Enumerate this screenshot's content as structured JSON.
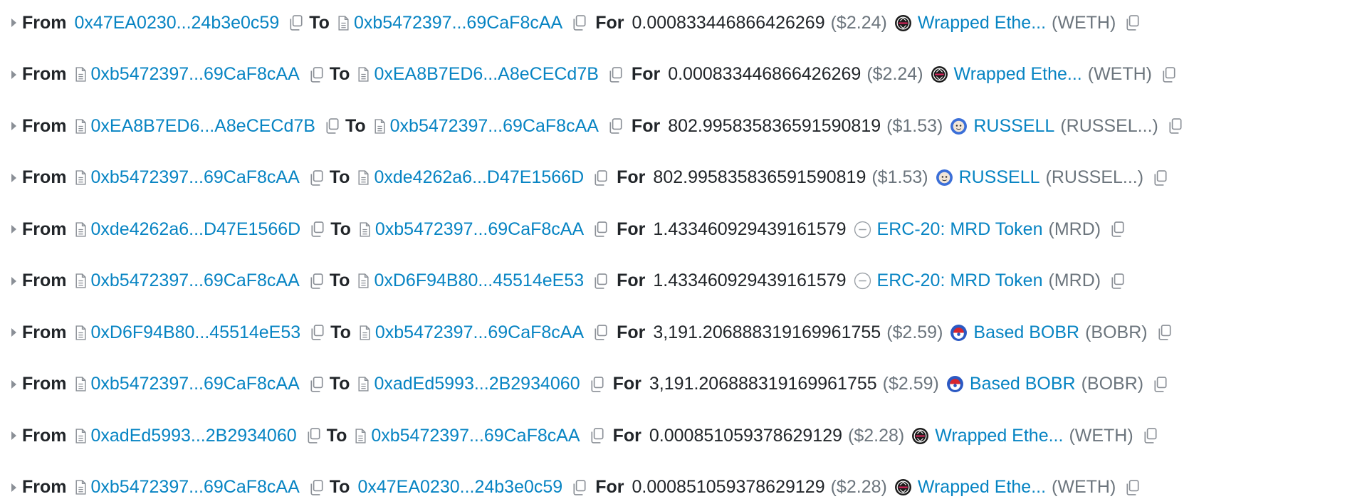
{
  "labels": {
    "from": "From",
    "to": "To",
    "for": "For"
  },
  "rows": [
    {
      "from": {
        "addr": "0x47EA0230...24b3e0c59",
        "contract": false
      },
      "to": {
        "addr": "0xb5472397...69CaF8cAA",
        "contract": true
      },
      "amount": "0.000833446866426269",
      "usd": "($2.24)",
      "token": {
        "name": "Wrapped Ethe...",
        "symbol": "(WETH)",
        "icon": "weth-icon"
      }
    },
    {
      "from": {
        "addr": "0xb5472397...69CaF8cAA",
        "contract": true
      },
      "to": {
        "addr": "0xEA8B7ED6...A8eCECd7B",
        "contract": true
      },
      "amount": "0.000833446866426269",
      "usd": "($2.24)",
      "token": {
        "name": "Wrapped Ethe...",
        "symbol": "(WETH)",
        "icon": "weth-icon"
      }
    },
    {
      "from": {
        "addr": "0xEA8B7ED6...A8eCECd7B",
        "contract": true
      },
      "to": {
        "addr": "0xb5472397...69CaF8cAA",
        "contract": true
      },
      "amount": "802.995835836591590819",
      "usd": "($1.53)",
      "token": {
        "name": "RUSSELL",
        "symbol": "(RUSSEL...)",
        "icon": "russell-icon"
      }
    },
    {
      "from": {
        "addr": "0xb5472397...69CaF8cAA",
        "contract": true
      },
      "to": {
        "addr": "0xde4262a6...D47E1566D",
        "contract": true
      },
      "amount": "802.995835836591590819",
      "usd": "($1.53)",
      "token": {
        "name": "RUSSELL",
        "symbol": "(RUSSEL...)",
        "icon": "russell-icon"
      }
    },
    {
      "from": {
        "addr": "0xde4262a6...D47E1566D",
        "contract": true
      },
      "to": {
        "addr": "0xb5472397...69CaF8cAA",
        "contract": true
      },
      "amount": "1.433460929439161579",
      "usd": "",
      "token": {
        "name": "ERC-20: MRD Token",
        "symbol": "(MRD)",
        "icon": "erc20-token-icon"
      }
    },
    {
      "from": {
        "addr": "0xb5472397...69CaF8cAA",
        "contract": true
      },
      "to": {
        "addr": "0xD6F94B80...45514eE53",
        "contract": true
      },
      "amount": "1.433460929439161579",
      "usd": "",
      "token": {
        "name": "ERC-20: MRD Token",
        "symbol": "(MRD)",
        "icon": "erc20-token-icon"
      }
    },
    {
      "from": {
        "addr": "0xD6F94B80...45514eE53",
        "contract": true
      },
      "to": {
        "addr": "0xb5472397...69CaF8cAA",
        "contract": true
      },
      "amount": "3,191.206888319169961755",
      "usd": "($2.59)",
      "token": {
        "name": "Based BOBR",
        "symbol": "(BOBR)",
        "icon": "bobr-icon"
      }
    },
    {
      "from": {
        "addr": "0xb5472397...69CaF8cAA",
        "contract": true
      },
      "to": {
        "addr": "0xadEd5993...2B2934060",
        "contract": true
      },
      "amount": "3,191.206888319169961755",
      "usd": "($2.59)",
      "token": {
        "name": "Based BOBR",
        "symbol": "(BOBR)",
        "icon": "bobr-icon"
      }
    },
    {
      "from": {
        "addr": "0xadEd5993...2B2934060",
        "contract": true
      },
      "to": {
        "addr": "0xb5472397...69CaF8cAA",
        "contract": true
      },
      "amount": "0.000851059378629129",
      "usd": "($2.28)",
      "token": {
        "name": "Wrapped Ethe...",
        "symbol": "(WETH)",
        "icon": "weth-icon"
      }
    },
    {
      "from": {
        "addr": "0xb5472397...69CaF8cAA",
        "contract": true
      },
      "to": {
        "addr": "0x47EA0230...24b3e0c59",
        "contract": false
      },
      "amount": "0.000851059378629129",
      "usd": "($2.28)",
      "token": {
        "name": "Wrapped Ethe...",
        "symbol": "(WETH)",
        "icon": "weth-icon"
      }
    }
  ]
}
